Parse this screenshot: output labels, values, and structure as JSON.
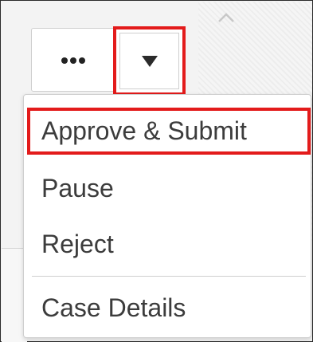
{
  "toolbar": {
    "more_icon": "more-horizontal-icon",
    "dropdown_icon": "caret-down-icon",
    "scroll_icon": "chevron-up-icon"
  },
  "menu": {
    "items": [
      {
        "label": "Approve & Submit",
        "highlighted": true
      },
      {
        "label": "Pause",
        "highlighted": false
      },
      {
        "label": "Reject",
        "highlighted": false
      },
      {
        "label": "Case Details",
        "highlighted": false
      }
    ]
  },
  "colors": {
    "highlight": "#e31b1b",
    "text": "#3c3c3c",
    "border": "#cfcfcf"
  }
}
